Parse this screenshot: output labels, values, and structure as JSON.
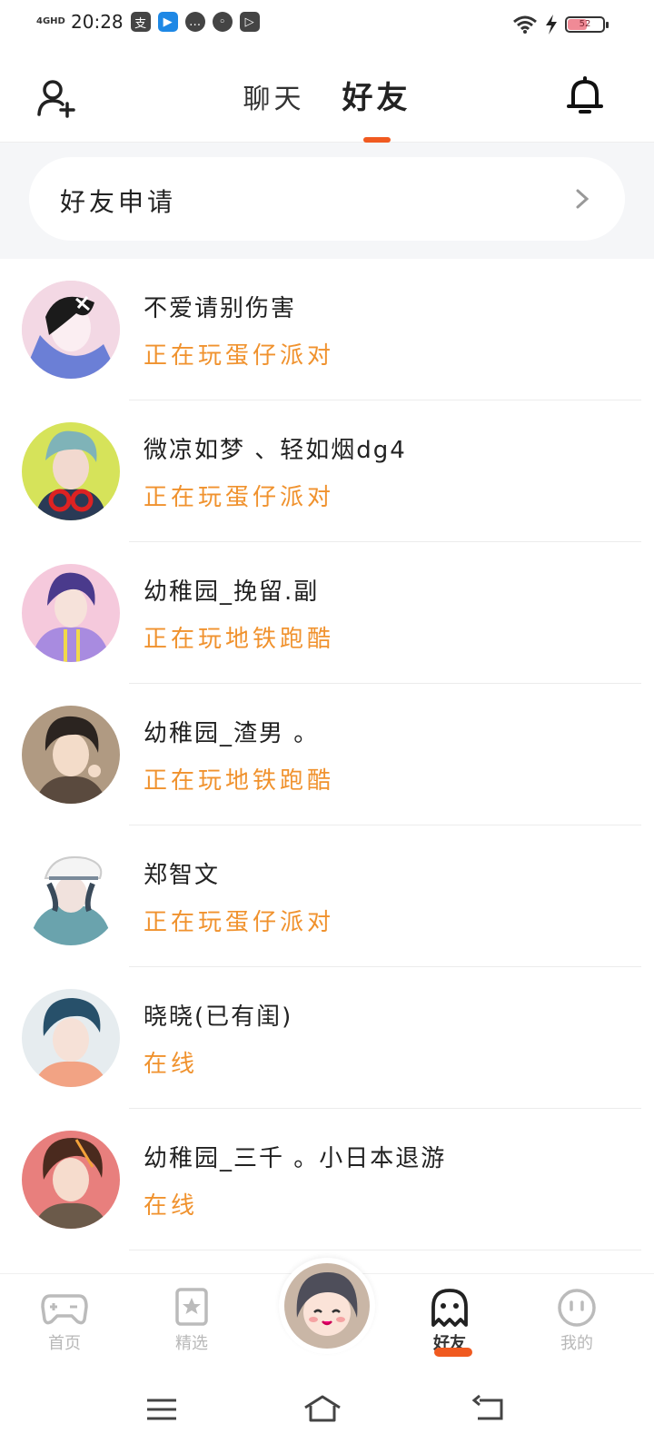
{
  "status_bar": {
    "network": "4GHD",
    "time": "20:28",
    "battery": "52"
  },
  "header": {
    "tabs": [
      {
        "label": "聊天",
        "active": false
      },
      {
        "label": "好友",
        "active": true
      }
    ]
  },
  "friend_request": {
    "label": "好友申请"
  },
  "friends": [
    {
      "name": "不爱请别伤害",
      "status": "正在玩蛋仔派对"
    },
    {
      "name": "微凉如梦 、轻如烟dg4",
      "status": "正在玩蛋仔派对"
    },
    {
      "name": "幼稚园_挽留.副",
      "status": "正在玩地铁跑酷"
    },
    {
      "name": "幼稚园_渣男 。",
      "status": "正在玩地铁跑酷"
    },
    {
      "name": "郑智文",
      "status": "正在玩蛋仔派对"
    },
    {
      "name": "晓晓(已有闺)",
      "status": "在线"
    },
    {
      "name": "幼稚园_三千 。小日本退游",
      "status": "在线"
    }
  ],
  "bottom_nav": {
    "items": [
      {
        "label": "首页",
        "icon": "gamepad-icon",
        "active": false
      },
      {
        "label": "精选",
        "icon": "star-icon",
        "active": false
      },
      {
        "label": "好友",
        "icon": "ghost-icon",
        "active": true
      },
      {
        "label": "我的",
        "icon": "face-icon",
        "active": false
      }
    ]
  },
  "colors": {
    "accent": "#f05a20",
    "status_text": "#f0922e"
  }
}
